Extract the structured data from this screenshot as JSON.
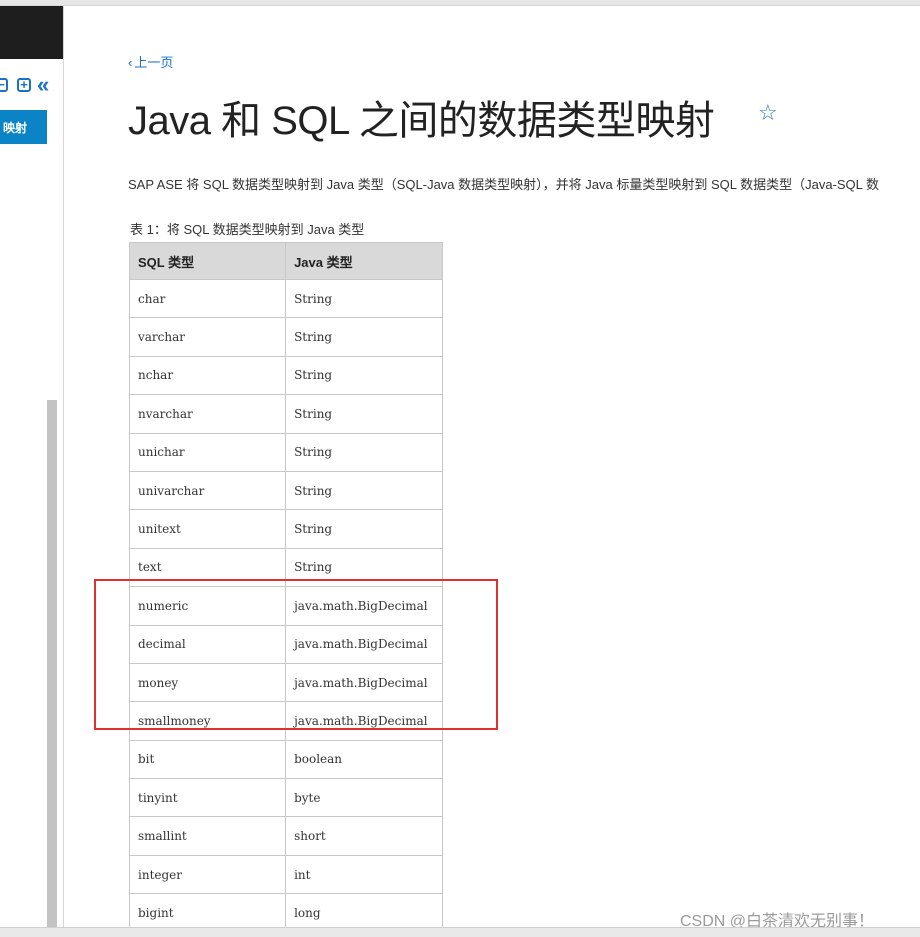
{
  "sidebar": {
    "controls": {
      "collapse_icon": "minus-box-icon",
      "expand_icon": "plus-box-icon",
      "hide_icon": "double-chevron-left-icon"
    },
    "active_item_label": "映射"
  },
  "nav": {
    "prev_label": "上一页"
  },
  "page": {
    "title": "Java 和 SQL 之间的数据类型映射",
    "star_icon": "star-outline-icon",
    "intro": "SAP ASE 将 SQL 数据类型映射到 Java 类型（SQL-Java 数据类型映射），并将 Java 标量类型映射到 SQL 数据类型（Java-SQL 数"
  },
  "table": {
    "caption": "表 1：将 SQL 数据类型映射到 Java 类型",
    "headers": [
      "SQL 类型",
      "Java 类型"
    ],
    "rows": [
      [
        "char",
        "String"
      ],
      [
        "varchar",
        "String"
      ],
      [
        "nchar",
        "String"
      ],
      [
        "nvarchar",
        "String"
      ],
      [
        "unichar",
        "String"
      ],
      [
        "univarchar",
        "String"
      ],
      [
        "unitext",
        "String"
      ],
      [
        "text",
        "String"
      ],
      [
        "numeric",
        "java.math.BigDecimal"
      ],
      [
        "decimal",
        "java.math.BigDecimal"
      ],
      [
        "money",
        "java.math.BigDecimal"
      ],
      [
        "smallmoney",
        "java.math.BigDecimal"
      ],
      [
        "bit",
        "boolean"
      ],
      [
        "tinyint",
        "byte"
      ],
      [
        "smallint",
        "short"
      ],
      [
        "integer",
        "int"
      ],
      [
        "bigint",
        "long"
      ]
    ]
  },
  "annotation": {
    "color": "#e0302f"
  },
  "watermark": "CSDN @白茶清欢无别事！",
  "colors": {
    "accent": "#1a73c8",
    "sidebar_active": "#0a84c6",
    "table_header": "#d9d9d9"
  }
}
